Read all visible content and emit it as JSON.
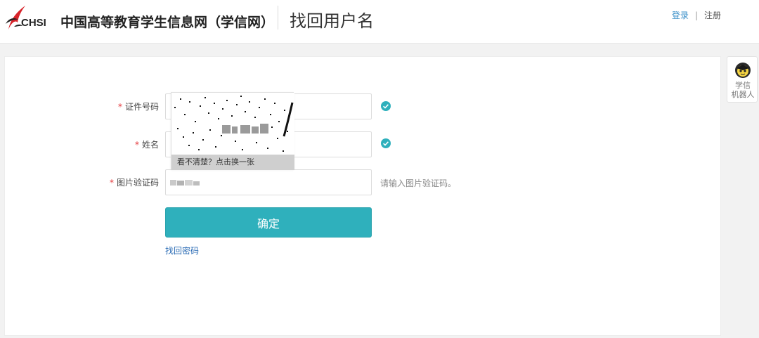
{
  "header": {
    "logo_text": "CHSI",
    "site_name": "中国高等教育学生信息网（学信网）",
    "page_title": "找回用户名",
    "login_label": "登录",
    "separator": "|",
    "register_label": "注册"
  },
  "robot": {
    "label_line1": "学信",
    "label_line2": "机器人"
  },
  "form": {
    "required_mark": "*",
    "id_number_label": "证件号码",
    "name_label": "姓名",
    "captcha_label": "图片验证码",
    "captcha_hint": "请输入图片验证码。",
    "captcha_refresh": "看不清楚？点击换一张",
    "submit_label": "确定",
    "forgot_password_label": "找回密码"
  },
  "colors": {
    "accent": "#2fb0bc",
    "link": "#2b6cb5",
    "required": "#e4393c",
    "logo_red": "#d7232a"
  }
}
